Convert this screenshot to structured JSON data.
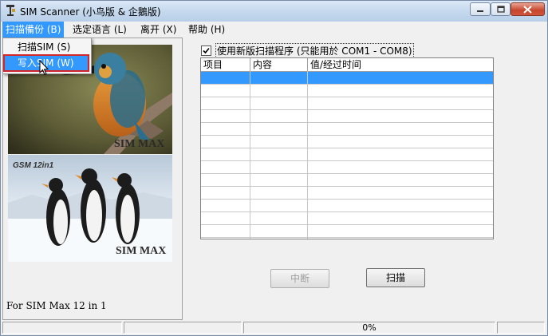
{
  "window": {
    "title": "SIM Scanner (小鸟版 & 企鵝版)"
  },
  "menubar": {
    "items": [
      {
        "label": "扫描備份 (B)"
      },
      {
        "label": "选定语言 (L)"
      },
      {
        "label": "离开 (X)"
      },
      {
        "label": "帮助 (H)"
      }
    ]
  },
  "dropdown": {
    "items": [
      {
        "label": "扫描SIM  (S)"
      },
      {
        "label": "写入SIM  (W)"
      }
    ]
  },
  "left_panel": {
    "image1_text": "SIM MAX",
    "image2_top_text": "GSM 12in1",
    "image2_text": "SIM MAX",
    "caption": "For SIM Max 12 in 1"
  },
  "options": {
    "new_scan_checkbox_label": "使用新版扫描程序 (只能用於 COM1 - COM8)",
    "new_scan_checked": true
  },
  "table": {
    "columns": [
      "项目",
      "内容",
      "值/经过时间"
    ],
    "rows": [],
    "selected_row": 0
  },
  "buttons": {
    "interrupt": "中断",
    "scan": "扫描"
  },
  "status": {
    "progress_text": "0%",
    "progress": 0
  },
  "colors": {
    "selection": "#3399ff",
    "highlight_outline": "#d3262b"
  }
}
